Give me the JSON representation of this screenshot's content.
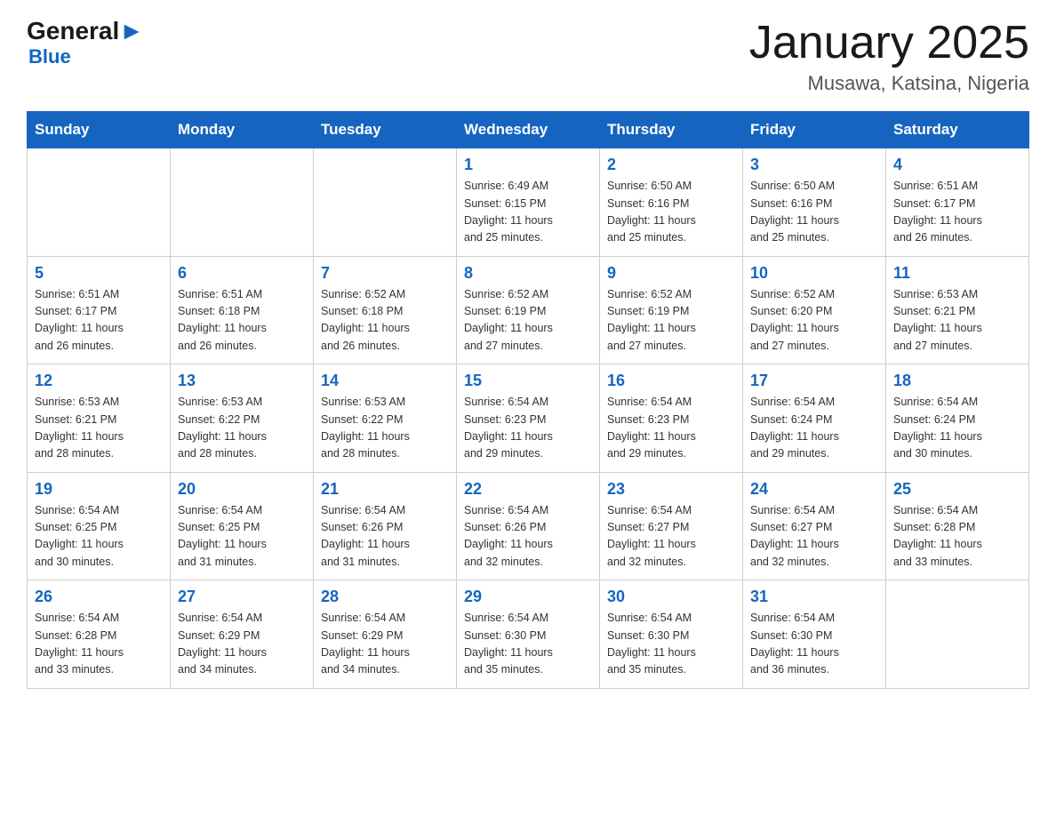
{
  "header": {
    "logo_general": "General",
    "logo_blue": "Blue",
    "month_title": "January 2025",
    "location": "Musawa, Katsina, Nigeria"
  },
  "weekdays": [
    "Sunday",
    "Monday",
    "Tuesday",
    "Wednesday",
    "Thursday",
    "Friday",
    "Saturday"
  ],
  "weeks": [
    [
      {
        "day": "",
        "info": ""
      },
      {
        "day": "",
        "info": ""
      },
      {
        "day": "",
        "info": ""
      },
      {
        "day": "1",
        "info": "Sunrise: 6:49 AM\nSunset: 6:15 PM\nDaylight: 11 hours\nand 25 minutes."
      },
      {
        "day": "2",
        "info": "Sunrise: 6:50 AM\nSunset: 6:16 PM\nDaylight: 11 hours\nand 25 minutes."
      },
      {
        "day": "3",
        "info": "Sunrise: 6:50 AM\nSunset: 6:16 PM\nDaylight: 11 hours\nand 25 minutes."
      },
      {
        "day": "4",
        "info": "Sunrise: 6:51 AM\nSunset: 6:17 PM\nDaylight: 11 hours\nand 26 minutes."
      }
    ],
    [
      {
        "day": "5",
        "info": "Sunrise: 6:51 AM\nSunset: 6:17 PM\nDaylight: 11 hours\nand 26 minutes."
      },
      {
        "day": "6",
        "info": "Sunrise: 6:51 AM\nSunset: 6:18 PM\nDaylight: 11 hours\nand 26 minutes."
      },
      {
        "day": "7",
        "info": "Sunrise: 6:52 AM\nSunset: 6:18 PM\nDaylight: 11 hours\nand 26 minutes."
      },
      {
        "day": "8",
        "info": "Sunrise: 6:52 AM\nSunset: 6:19 PM\nDaylight: 11 hours\nand 27 minutes."
      },
      {
        "day": "9",
        "info": "Sunrise: 6:52 AM\nSunset: 6:19 PM\nDaylight: 11 hours\nand 27 minutes."
      },
      {
        "day": "10",
        "info": "Sunrise: 6:52 AM\nSunset: 6:20 PM\nDaylight: 11 hours\nand 27 minutes."
      },
      {
        "day": "11",
        "info": "Sunrise: 6:53 AM\nSunset: 6:21 PM\nDaylight: 11 hours\nand 27 minutes."
      }
    ],
    [
      {
        "day": "12",
        "info": "Sunrise: 6:53 AM\nSunset: 6:21 PM\nDaylight: 11 hours\nand 28 minutes."
      },
      {
        "day": "13",
        "info": "Sunrise: 6:53 AM\nSunset: 6:22 PM\nDaylight: 11 hours\nand 28 minutes."
      },
      {
        "day": "14",
        "info": "Sunrise: 6:53 AM\nSunset: 6:22 PM\nDaylight: 11 hours\nand 28 minutes."
      },
      {
        "day": "15",
        "info": "Sunrise: 6:54 AM\nSunset: 6:23 PM\nDaylight: 11 hours\nand 29 minutes."
      },
      {
        "day": "16",
        "info": "Sunrise: 6:54 AM\nSunset: 6:23 PM\nDaylight: 11 hours\nand 29 minutes."
      },
      {
        "day": "17",
        "info": "Sunrise: 6:54 AM\nSunset: 6:24 PM\nDaylight: 11 hours\nand 29 minutes."
      },
      {
        "day": "18",
        "info": "Sunrise: 6:54 AM\nSunset: 6:24 PM\nDaylight: 11 hours\nand 30 minutes."
      }
    ],
    [
      {
        "day": "19",
        "info": "Sunrise: 6:54 AM\nSunset: 6:25 PM\nDaylight: 11 hours\nand 30 minutes."
      },
      {
        "day": "20",
        "info": "Sunrise: 6:54 AM\nSunset: 6:25 PM\nDaylight: 11 hours\nand 31 minutes."
      },
      {
        "day": "21",
        "info": "Sunrise: 6:54 AM\nSunset: 6:26 PM\nDaylight: 11 hours\nand 31 minutes."
      },
      {
        "day": "22",
        "info": "Sunrise: 6:54 AM\nSunset: 6:26 PM\nDaylight: 11 hours\nand 32 minutes."
      },
      {
        "day": "23",
        "info": "Sunrise: 6:54 AM\nSunset: 6:27 PM\nDaylight: 11 hours\nand 32 minutes."
      },
      {
        "day": "24",
        "info": "Sunrise: 6:54 AM\nSunset: 6:27 PM\nDaylight: 11 hours\nand 32 minutes."
      },
      {
        "day": "25",
        "info": "Sunrise: 6:54 AM\nSunset: 6:28 PM\nDaylight: 11 hours\nand 33 minutes."
      }
    ],
    [
      {
        "day": "26",
        "info": "Sunrise: 6:54 AM\nSunset: 6:28 PM\nDaylight: 11 hours\nand 33 minutes."
      },
      {
        "day": "27",
        "info": "Sunrise: 6:54 AM\nSunset: 6:29 PM\nDaylight: 11 hours\nand 34 minutes."
      },
      {
        "day": "28",
        "info": "Sunrise: 6:54 AM\nSunset: 6:29 PM\nDaylight: 11 hours\nand 34 minutes."
      },
      {
        "day": "29",
        "info": "Sunrise: 6:54 AM\nSunset: 6:30 PM\nDaylight: 11 hours\nand 35 minutes."
      },
      {
        "day": "30",
        "info": "Sunrise: 6:54 AM\nSunset: 6:30 PM\nDaylight: 11 hours\nand 35 minutes."
      },
      {
        "day": "31",
        "info": "Sunrise: 6:54 AM\nSunset: 6:30 PM\nDaylight: 11 hours\nand 36 minutes."
      },
      {
        "day": "",
        "info": ""
      }
    ]
  ]
}
